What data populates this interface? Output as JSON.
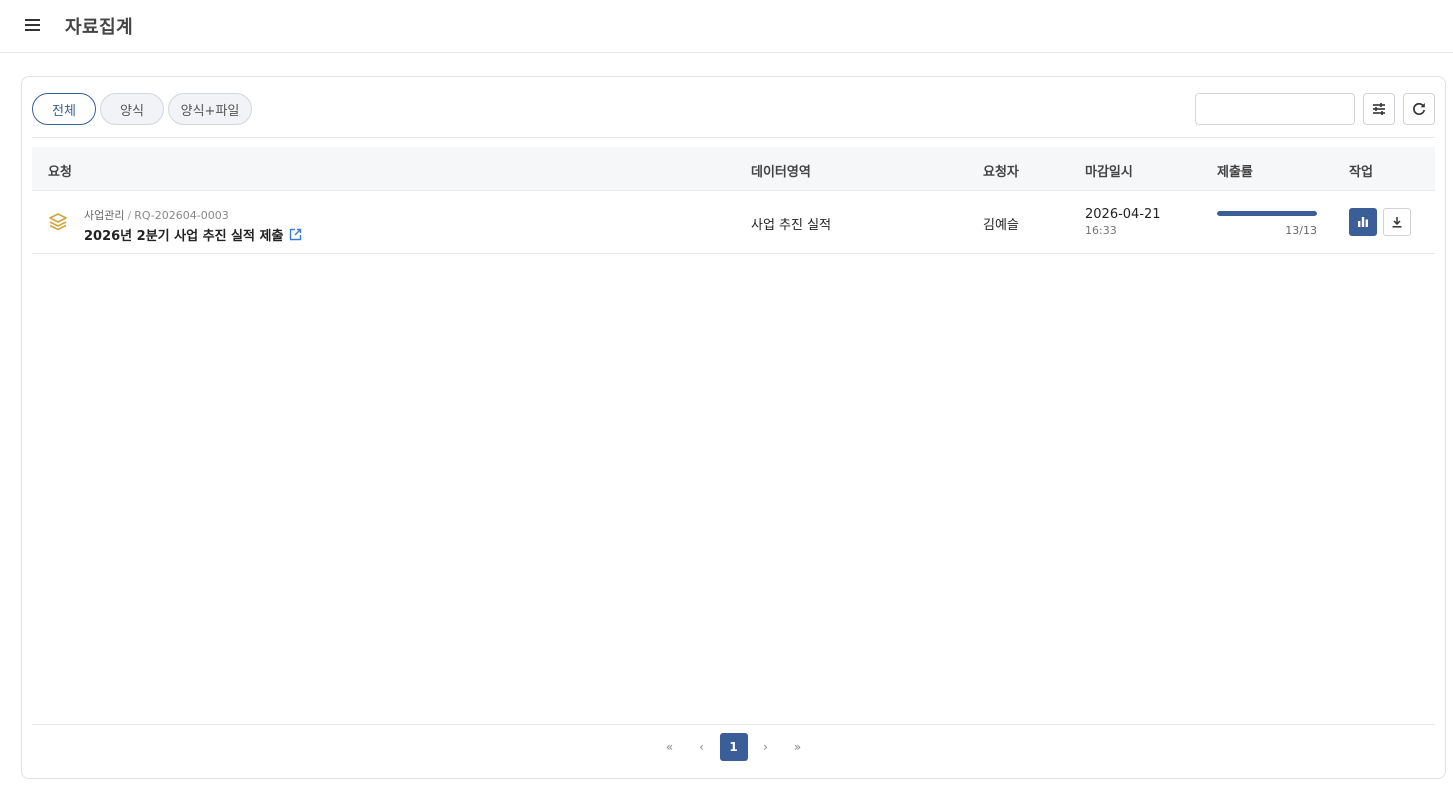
{
  "header": {
    "title": "자료집계"
  },
  "filters": {
    "tabs": [
      {
        "label": "전체",
        "active": true
      },
      {
        "label": "양식",
        "active": false
      },
      {
        "label": "양식+파일",
        "active": false
      }
    ],
    "search_value": ""
  },
  "table": {
    "columns": [
      "요청",
      "데이터영역",
      "요청자",
      "마감일시",
      "제출률",
      "작업"
    ],
    "rows": [
      {
        "category": "사업관리",
        "code": "RQ-202604-0003",
        "title": "2026년 2분기 사업 추진 실적 제출",
        "data_area": "사업 추진 실적",
        "requester": "김예슬",
        "deadline_date": "2026-04-21",
        "deadline_time": "16:33",
        "rate_text": "13/13",
        "rate_fraction": 1.0
      }
    ]
  },
  "pagination": {
    "first": "«",
    "prev": "‹",
    "current": "1",
    "next": "›",
    "last": "»"
  },
  "icons": {
    "menu": "hamburger-icon",
    "settings": "sliders-icon",
    "refresh": "refresh-icon",
    "row": "layers-icon",
    "open": "external-link-icon",
    "chart": "bar-chart-icon",
    "download": "download-icon"
  },
  "colors": {
    "accent": "#3a5e97",
    "layers_icon": "#d4a53c",
    "link_icon": "#3a7bd5"
  }
}
